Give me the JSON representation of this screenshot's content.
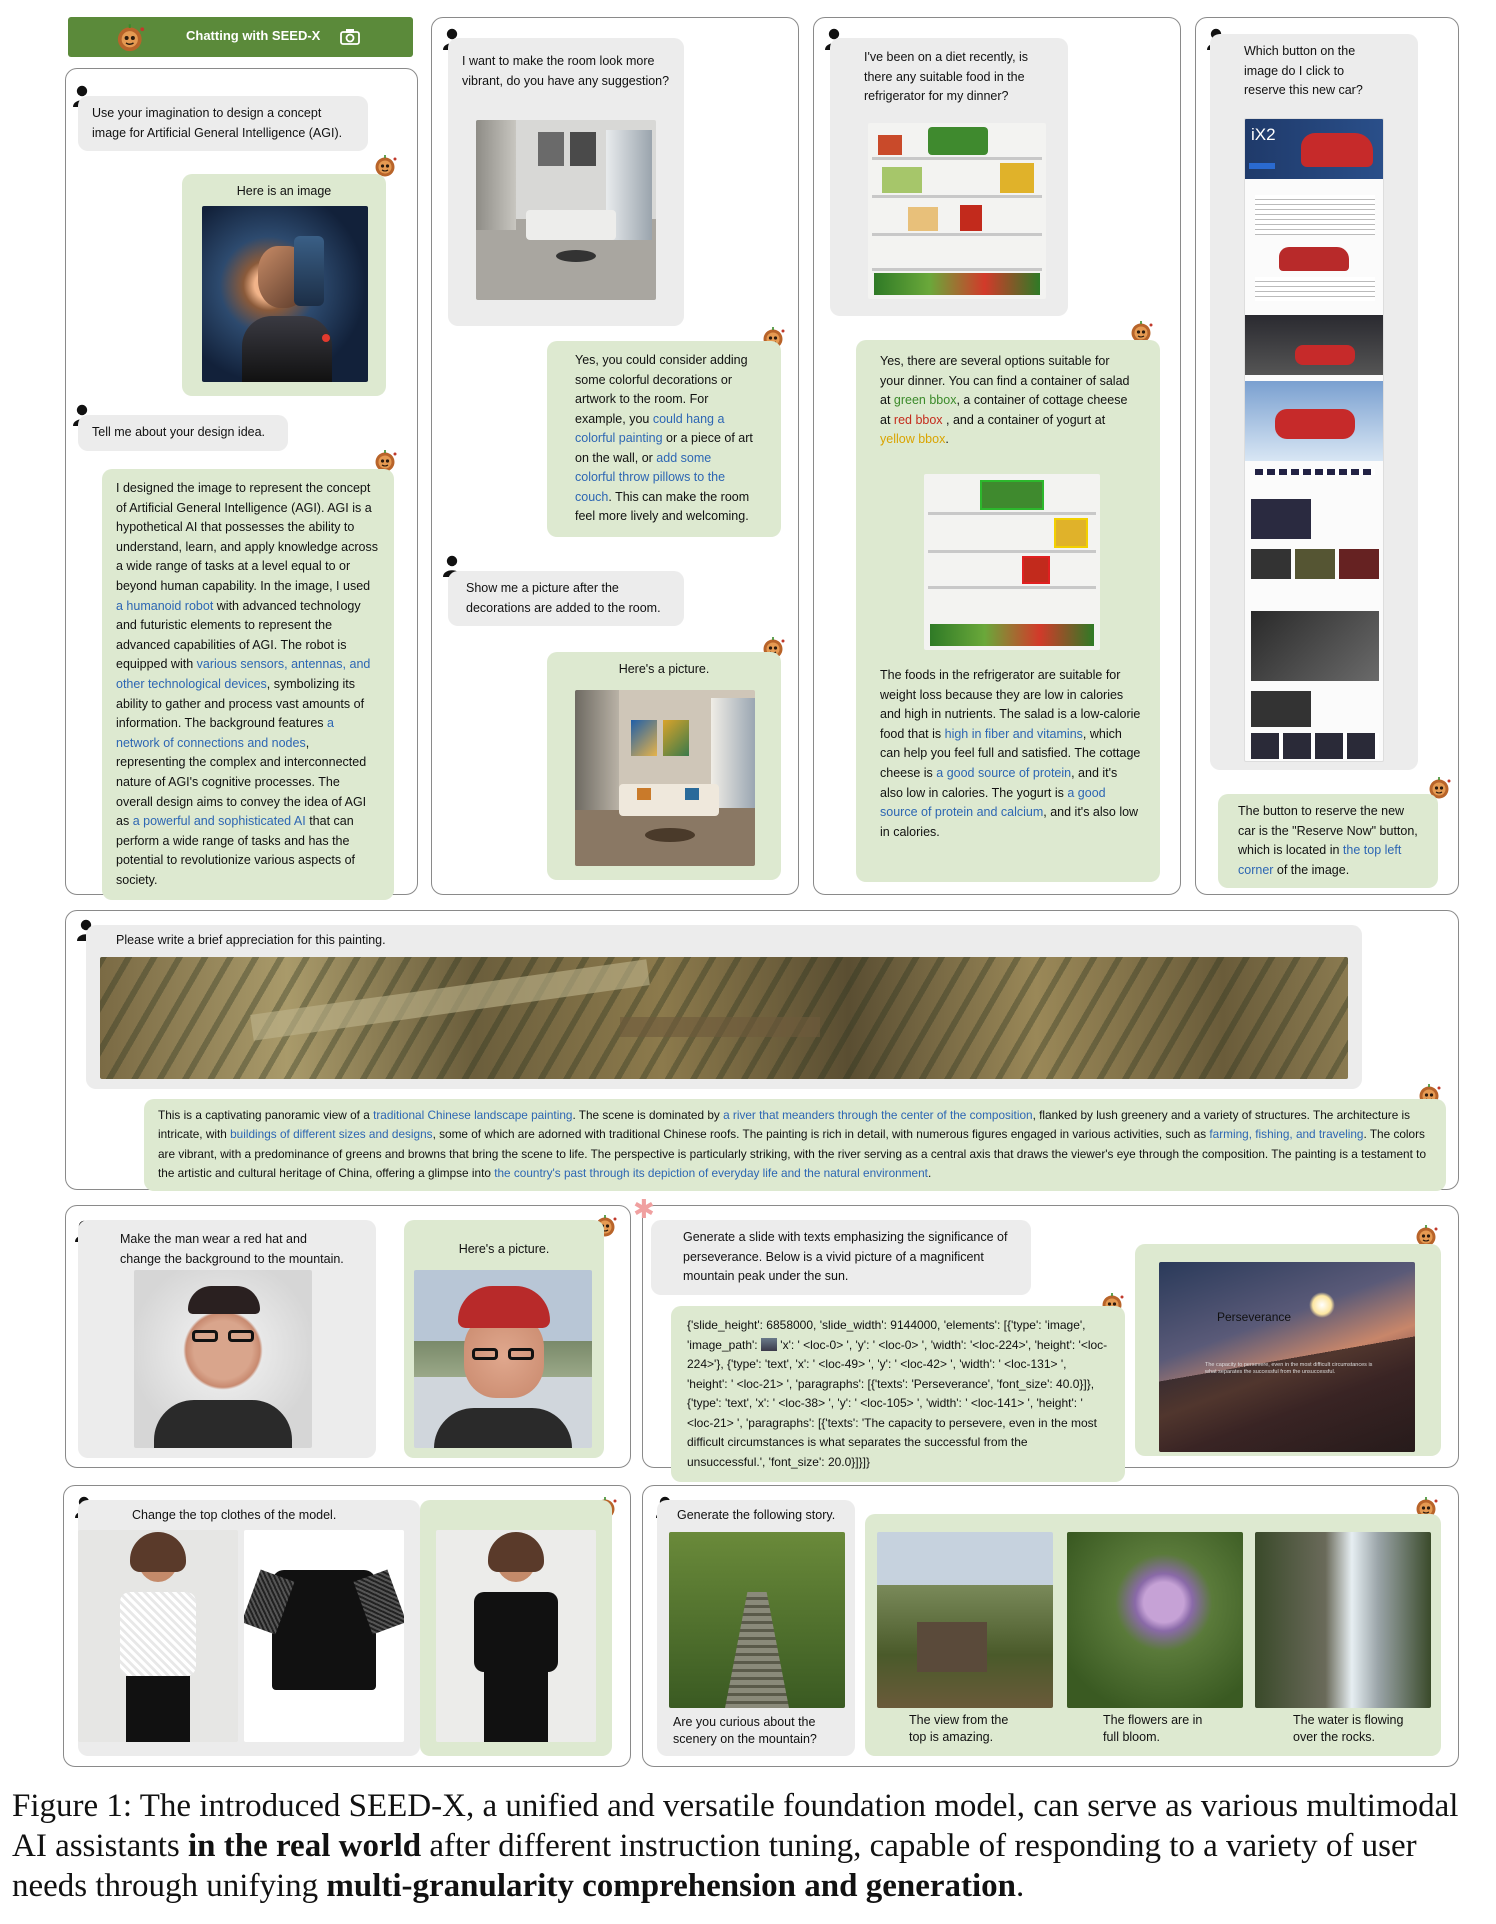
{
  "header": {
    "title": "Chatting with SEED-X"
  },
  "p1": {
    "u1": "Use your imagination to design a concept image for Artificial General Intelligence (AGI).",
    "b1": "Here is an image",
    "u2": "Tell me about your design idea.",
    "b2": [
      "I designed the image to represent the concept of Artificial General Intelligence (AGI). AGI is a hypothetical AI that possesses the ability to understand, learn, and apply knowledge across a wide range of tasks at a level equal to or beyond human capability. In the image, I used ",
      "a humanoid robot",
      " with advanced technology and futuristic elements to represent the advanced capabilities of AGI. The robot is equipped with ",
      "various sensors, antennas, and other technological devices",
      ", symbolizing its ability to gather and process vast amounts of information. The background features ",
      "a network of connections and nodes",
      ", representing the complex and interconnected nature of AGI's cognitive processes. The overall design aims to convey the idea of AGI as ",
      "a powerful and sophisticated AI",
      " that can perform a wide range of tasks and has the potential to revolutionize various aspects of society."
    ]
  },
  "p2": {
    "u1": "I want to make the room look more vibrant, do you have any suggestion?",
    "b1": [
      "Yes, you could consider adding some colorful decorations or artwork to the room. For example, you ",
      "could hang a colorful painting",
      " or a piece of art on the wall, or ",
      "add some colorful throw pillows to the couch",
      ". This can make the room feel more lively and welcoming."
    ],
    "u2": "Show me a picture after the decorations are added to the room.",
    "b2": "Here's a picture."
  },
  "p3": {
    "u1": "I've been on a diet recently, is there any suitable food in the refrigerator for my dinner?",
    "b1": [
      "Yes, there are several options suitable for your dinner. You can find a container of salad at ",
      "green bbox",
      ", a container of cottage cheese at ",
      "red bbox",
      " , and a container of yogurt at ",
      "yellow bbox",
      "."
    ],
    "b2": [
      "The foods in the refrigerator are suitable for weight loss because they are low in calories and high in nutrients. The salad is a low-calorie food that is ",
      "high in fiber and vitamins",
      ", which can help you feel full and satisfied. The cottage cheese is ",
      "a good source of protein",
      ", and it's also low in calories. The yogurt is ",
      "a good source of protein and calcium",
      ", and it's also low in calories."
    ]
  },
  "p4": {
    "u1": "Which button on the image do I click to reserve this new car?",
    "shot_brand": "iX2",
    "b1": [
      "The button to reserve the new car is the \"Reserve Now\" button, which is located in ",
      "the top left corner",
      " of the image."
    ]
  },
  "p5": {
    "u1": "Please write a brief appreciation for this painting.",
    "b1": [
      "This is a captivating panoramic view of a ",
      "traditional Chinese landscape painting",
      ". The scene is dominated by ",
      "a river that meanders through the center of the composition",
      ", flanked by lush greenery and a variety of structures. The architecture is intricate, with ",
      "buildings of different sizes and designs",
      ", some of which are adorned with traditional Chinese roofs. The painting is rich in detail, with numerous figures engaged in various activities, such as ",
      "farming, fishing, and traveling",
      ". The colors are vibrant, with a predominance of greens and browns that bring the scene to life. The perspective is particularly striking, with the river serving as a central axis that draws the viewer's eye through the composition. The painting is a testament to the artistic and cultural heritage of China, offering a glimpse into ",
      "the country's past through its depiction of everyday life and the natural environment",
      "."
    ]
  },
  "p6": {
    "u1": "Make the man wear a red hat and change the background to the mountain.",
    "b1": "Here's a picture."
  },
  "p7": {
    "u1": "Generate a slide with texts emphasizing the significance of perseverance. Below is a vivid picture of a magnificent mountain peak under the sun.",
    "code": "{'slide_height': 6858000, 'slide_width': 9144000, 'elements': [{'type': 'image', 'image_path': ",
    "code2": " 'x': ' <loc-0> ', 'y': ' <loc-0> ', 'width': '<loc-224>', 'height': '<loc-224>'}, {'type': 'text', 'x': ' <loc-49> ', 'y': ' <loc-42> ', 'width': ' <loc-131> ', 'height': ' <loc-21> ', 'paragraphs': [{'texts': 'Perseverance', 'font_size': 40.0}]}, {'type': 'text', 'x': ' <loc-38> ', 'y': ' <loc-105> ', 'width': ' <loc-141> ', 'height': ' <loc-21> ', 'paragraphs': [{'texts': 'The capacity to persevere, even in the most difficult circumstances is what separates the successful from the unsuccessful.', 'font_size': 20.0}]}]}",
    "slide_title": "Perseverance",
    "slide_text": "The capacity to persevere, even in the most difficult circumstances is what separates the successful from the unsuccessful."
  },
  "p8": {
    "u1": "Change the top clothes of the model."
  },
  "p9": {
    "u1": "Generate the following story.",
    "cap0": "Are you curious about the scenery on the mountain?",
    "cap1": "The view from the top is amazing.",
    "cap2": "The flowers are in full bloom.",
    "cap3": "The water is flowing over the rocks."
  },
  "caption": {
    "a": "Figure 1: The introduced SEED-X, a unified and versatile foundation model, can serve as various multimodal AI assistants ",
    "b": "in the real world",
    "c": " after different instruction tuning, capable of responding to a variety of user needs through unifying  ",
    "d": "multi-granularity comprehension and generation",
    "e": "."
  },
  "colors": {
    "link": "#2d66b3",
    "bubble_user": "#ececec",
    "bubble_bot": "#dde9d0",
    "header": "#5b8a3a"
  }
}
